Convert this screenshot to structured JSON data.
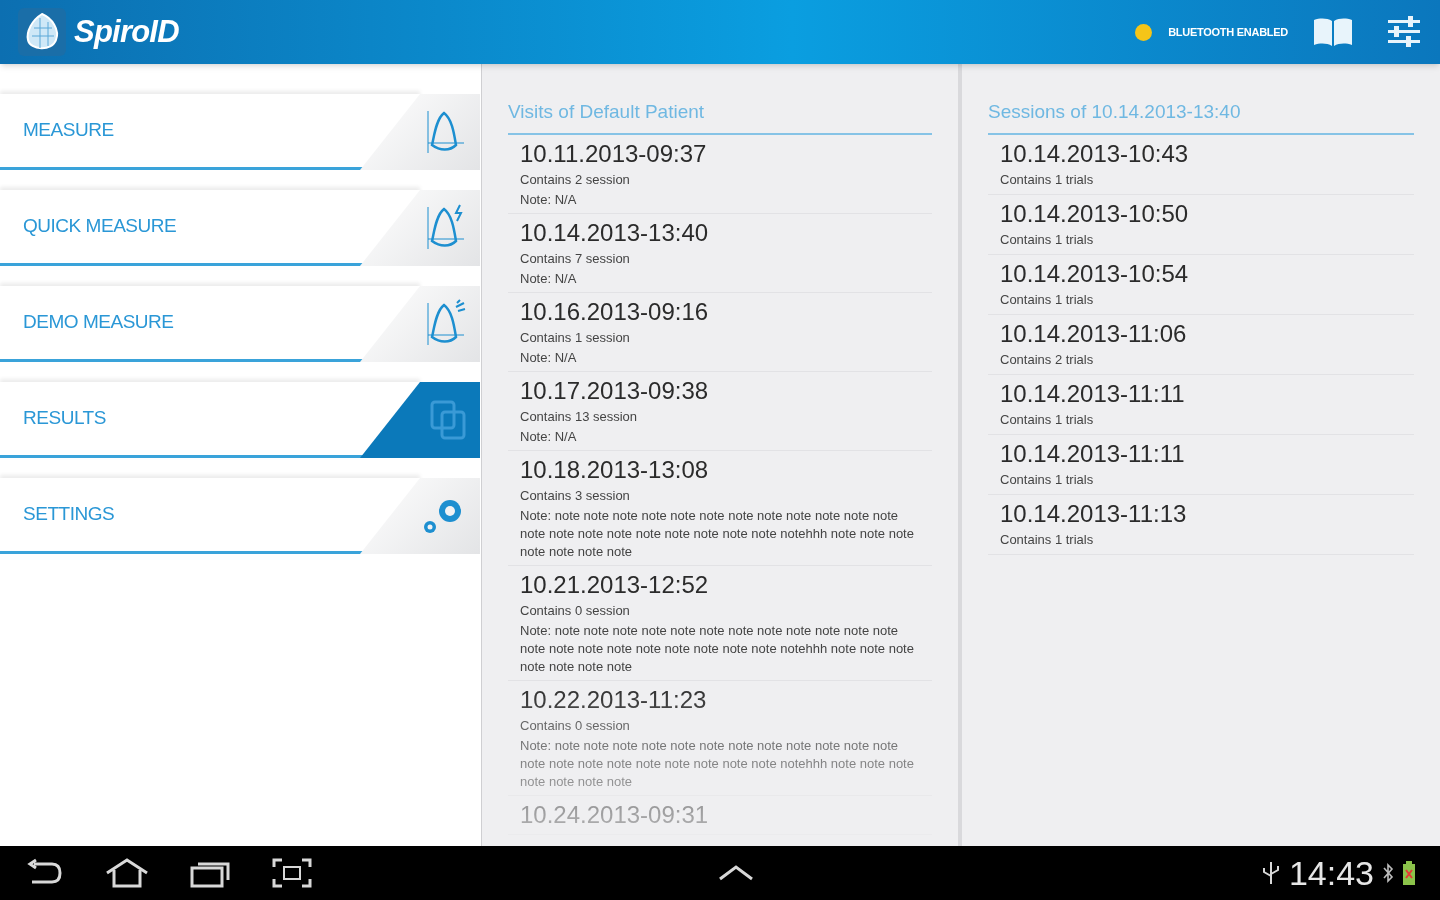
{
  "header": {
    "app_name": "SpiroID",
    "bluetooth": {
      "label": "BLUETOOTH ENABLED",
      "on": true
    }
  },
  "menu": [
    {
      "label": "MEASURE",
      "selected": false
    },
    {
      "label": "QUICK MEASURE",
      "selected": false
    },
    {
      "label": "DEMO MEASURE",
      "selected": false
    },
    {
      "label": "RESULTS",
      "selected": true
    },
    {
      "label": "SETTINGS",
      "selected": false
    }
  ],
  "visits": {
    "title": "Visits of Default Patient",
    "items": [
      {
        "date": "10.11.2013-09:37",
        "summary": "Contains 2 session",
        "note": "Note: N/A"
      },
      {
        "date": "10.14.2013-13:40",
        "summary": "Contains 7 session",
        "note": "Note: N/A"
      },
      {
        "date": "10.16.2013-09:16",
        "summary": "Contains 1 session",
        "note": "Note: N/A"
      },
      {
        "date": "10.17.2013-09:38",
        "summary": "Contains 13 session",
        "note": "Note: N/A"
      },
      {
        "date": "10.18.2013-13:08",
        "summary": "Contains 3 session",
        "note": "Note: note note note note note note note note note note note note note note note note note note note note note notehhh note note note note note note note"
      },
      {
        "date": "10.21.2013-12:52",
        "summary": "Contains 0 session",
        "note": "Note: note note note note note note note note note note note note note note note note note note note note note notehhh note note note note note note note"
      },
      {
        "date": "10.22.2013-11:23",
        "summary": "Contains 0 session",
        "note": "Note: note note note note note note note note note note note note note note note note note note note note note notehhh note note note note note note note"
      },
      {
        "date": "10.24.2013-09:31"
      }
    ]
  },
  "sessions": {
    "title": "Sessions of 10.14.2013-13:40",
    "items": [
      {
        "date": "10.14.2013-10:43",
        "summary": "Contains 1 trials"
      },
      {
        "date": "10.14.2013-10:50",
        "summary": "Contains 1 trials"
      },
      {
        "date": "10.14.2013-10:54",
        "summary": "Contains 1 trials"
      },
      {
        "date": "10.14.2013-11:06",
        "summary": "Contains 2 trials"
      },
      {
        "date": "10.14.2013-11:11",
        "summary": "Contains 1 trials"
      },
      {
        "date": "10.14.2013-11:11",
        "summary": "Contains 1 trials"
      },
      {
        "date": "10.14.2013-11:13",
        "summary": "Contains 1 trials"
      }
    ]
  },
  "status_bar": {
    "time": "14:43"
  }
}
